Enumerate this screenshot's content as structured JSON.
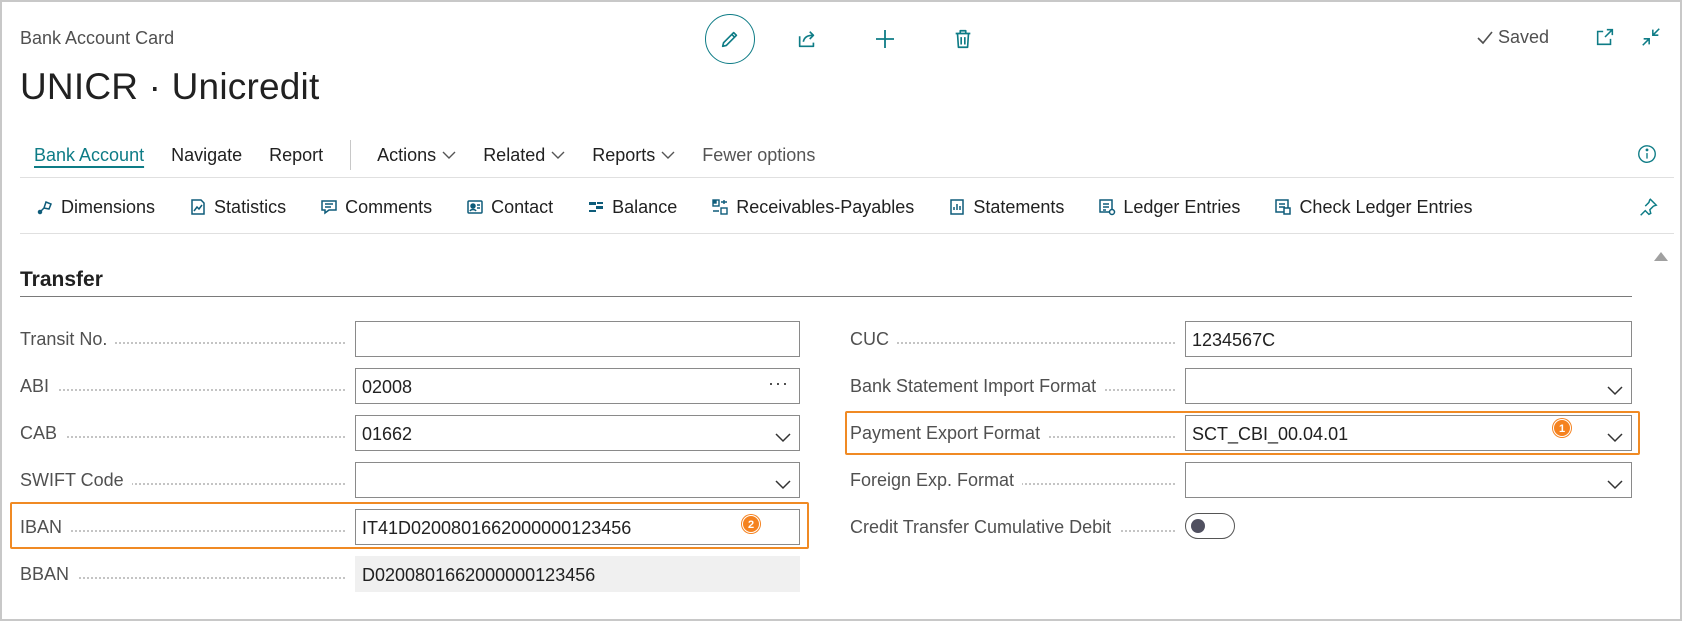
{
  "header": {
    "caption": "Bank Account Card",
    "title": "UNICR · Unicredit",
    "saved_label": "Saved"
  },
  "menu": {
    "items": [
      {
        "label": "Bank Account",
        "active": true
      },
      {
        "label": "Navigate"
      },
      {
        "label": "Report"
      }
    ],
    "dropdowns": [
      {
        "label": "Actions"
      },
      {
        "label": "Related"
      },
      {
        "label": "Reports"
      }
    ],
    "fewer_options": "Fewer options"
  },
  "actions": [
    {
      "label": "Dimensions",
      "icon": "dimensions-icon"
    },
    {
      "label": "Statistics",
      "icon": "statistics-icon"
    },
    {
      "label": "Comments",
      "icon": "comments-icon"
    },
    {
      "label": "Contact",
      "icon": "contact-icon"
    },
    {
      "label": "Balance",
      "icon": "balance-icon"
    },
    {
      "label": "Receivables-Payables",
      "icon": "receivables-payables-icon"
    },
    {
      "label": "Statements",
      "icon": "statements-icon"
    },
    {
      "label": "Ledger Entries",
      "icon": "ledger-entries-icon"
    },
    {
      "label": "Check Ledger Entries",
      "icon": "check-ledger-entries-icon"
    }
  ],
  "section": {
    "title": "Transfer",
    "left_fields": [
      {
        "label": "Transit No.",
        "value": ""
      },
      {
        "label": "ABI",
        "value": "02008"
      },
      {
        "label": "CAB",
        "value": "01662"
      },
      {
        "label": "SWIFT Code",
        "value": ""
      },
      {
        "label": "IBAN",
        "value": "IT41D0200801662000000123456"
      },
      {
        "label": "BBAN",
        "value": "D0200801662000000123456"
      }
    ],
    "right_fields": [
      {
        "label": "CUC",
        "value": "1234567C"
      },
      {
        "label": "Bank Statement Import Format",
        "value": ""
      },
      {
        "label": "Payment Export Format",
        "value": "SCT_CBI_00.04.01"
      },
      {
        "label": "Foreign Exp. Format",
        "value": ""
      },
      {
        "label": "Credit Transfer Cumulative Debit",
        "value": false
      }
    ]
  },
  "badges": {
    "payment_export": "1",
    "iban": "2"
  },
  "colors": {
    "accent": "#0e7c86",
    "highlight": "#f08a24",
    "badge": "#f5821f"
  }
}
